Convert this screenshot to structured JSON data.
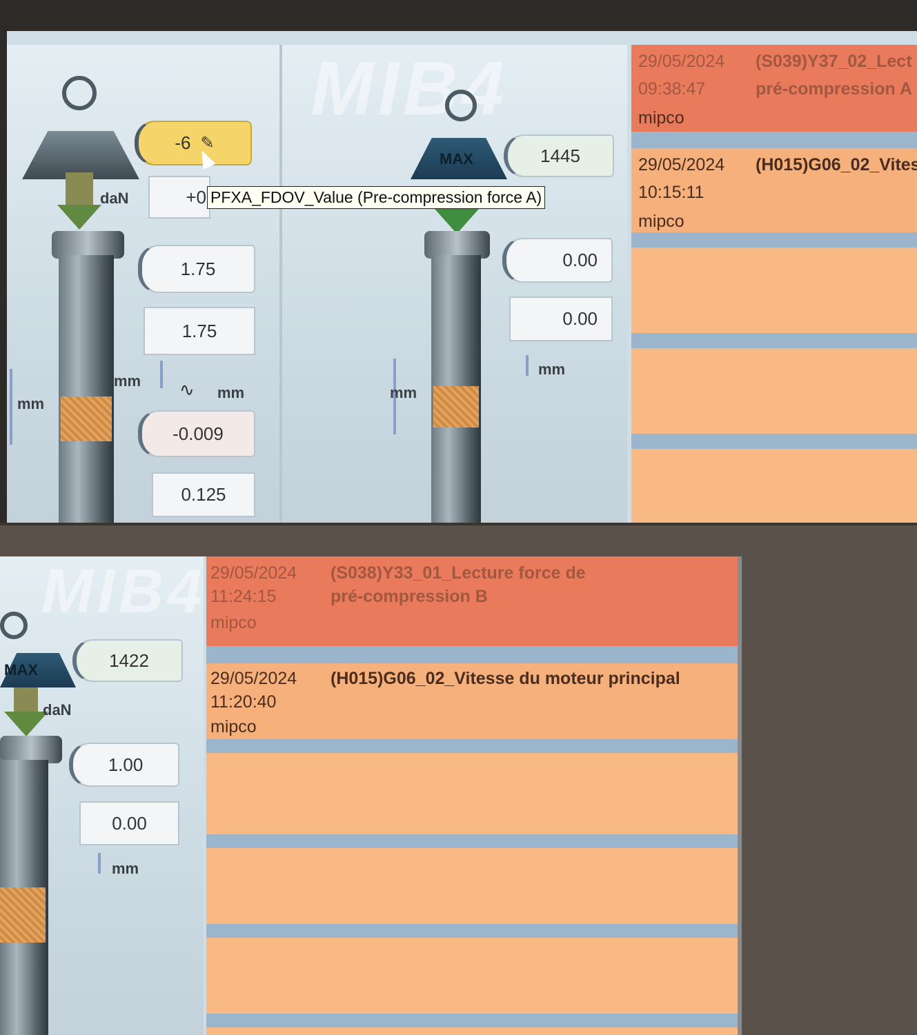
{
  "top_view": {
    "watermark": "MIB4",
    "station_a": {
      "force_value": "-6",
      "force_unit": "daN",
      "force_setpoint": "+0",
      "height_1": "1.75",
      "height_2": "1.75",
      "unit_mm_left": "mm",
      "unit_mm_mid": "mm",
      "unit_mm_wave": "mm",
      "deviation": "-0.009",
      "tolerance": "0.125"
    },
    "tooltip": "PFXA_FDOV_Value (Pre-compression force A)",
    "station_b": {
      "max_label": "MAX",
      "force_value": "1445",
      "height_1": "0.00",
      "height_2": "0.00",
      "unit_mm_left": "mm",
      "unit_mm_right": "mm"
    },
    "events": [
      {
        "date": "29/05/2024",
        "time": "09:38:47",
        "user": "mipco",
        "message_1": "(S039)Y37_02_Lect",
        "message_2": "pré-compression A",
        "severity": "alarm"
      },
      {
        "date": "29/05/2024",
        "time": "10:15:11",
        "user": "mipco",
        "message_1": "(H015)G06_02_Vites",
        "message_2": "",
        "severity": "warning"
      }
    ]
  },
  "bottom_view": {
    "watermark": "MIB4",
    "station_b": {
      "max_label": "MAX",
      "force_value": "1422",
      "force_unit": "daN",
      "height_1": "1.00",
      "height_2": "0.00",
      "unit_mm": "mm"
    },
    "events": [
      {
        "date": "29/05/2024",
        "time": "11:24:15",
        "user": "mipco",
        "message_1": "(S038)Y33_01_Lecture force de",
        "message_2": "pré-compression B",
        "severity": "alarm"
      },
      {
        "date": "29/05/2024",
        "time": "11:20:40",
        "user": "mipco",
        "message_1": "(H015)G06_02_Vitesse du moteur principal",
        "message_2": "",
        "severity": "warning"
      }
    ]
  },
  "colors": {
    "alarm": "#ea7a5c",
    "warning": "#f5b07c",
    "separator": "#9bb6cc",
    "yellow_field": "#f5d56a"
  },
  "icons": [
    "weight-icon",
    "edit-icon",
    "cursor-icon",
    "sine-wave-icon",
    "down-arrow-icon"
  ]
}
